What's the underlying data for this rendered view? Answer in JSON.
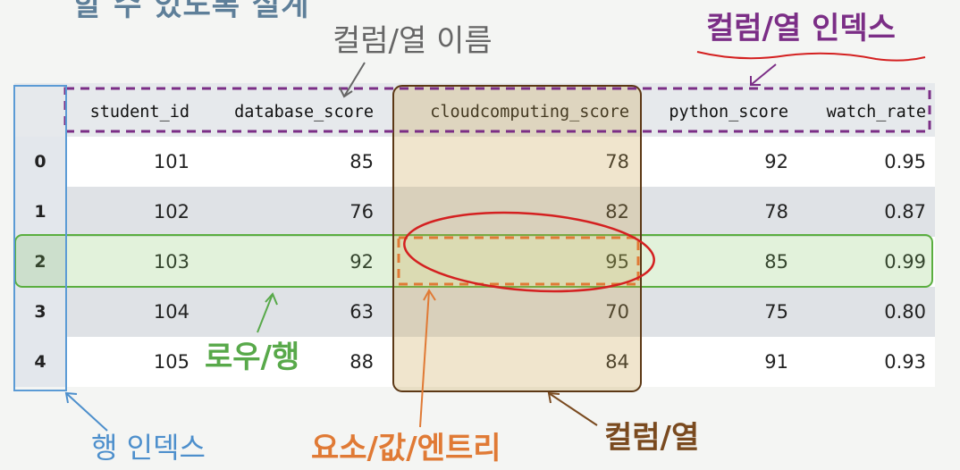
{
  "title_partial": "할 수 있도록 설계",
  "annotations": {
    "column_name": "컬럼/열 이름",
    "column_index": "컬럼/열 인덱스",
    "row": "로우/행",
    "row_index": "행 인덱스",
    "entry": "요소/값/엔트리",
    "column": "컬럼/열"
  },
  "table": {
    "columns": [
      "student_id",
      "database_score",
      "cloudcomputing_score",
      "python_score",
      "watch_rate"
    ],
    "rows": [
      {
        "index": "0",
        "cells": [
          "101",
          "85",
          "78",
          "92",
          "0.95"
        ]
      },
      {
        "index": "1",
        "cells": [
          "102",
          "76",
          "82",
          "78",
          "0.87"
        ]
      },
      {
        "index": "2",
        "cells": [
          "103",
          "92",
          "95",
          "85",
          "0.99"
        ]
      },
      {
        "index": "3",
        "cells": [
          "104",
          "63",
          "70",
          "75",
          "0.80"
        ]
      },
      {
        "index": "4",
        "cells": [
          "105",
          "88",
          "84",
          "91",
          "0.93"
        ]
      }
    ]
  },
  "colors": {
    "row_highlight": "#5aae3f",
    "column_highlight": "#7a4a1f",
    "column_index_box": "#7b2e86",
    "row_index_box": "#4d8fcc",
    "entry_box": "#e07a35",
    "circle": "#d42020"
  }
}
